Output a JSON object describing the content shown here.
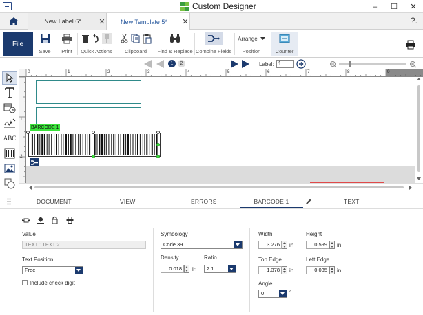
{
  "window": {
    "title": "Custom Designer",
    "controls": [
      "–",
      "☐",
      "✕"
    ]
  },
  "tabs": {
    "items": [
      {
        "label": "New Label 6*",
        "close": "✕"
      },
      {
        "label": "New Template 5*",
        "close": "✕"
      }
    ],
    "help": "?."
  },
  "ribbon": {
    "file": "File",
    "save": "Save",
    "print": "Print",
    "quick_actions": "Quick Actions",
    "clipboard": "Clipboard",
    "find_replace": "Find & Replace",
    "combine_fields": "Combine Fields",
    "arrange": "Arrange",
    "position": "Position",
    "counter": "Counter"
  },
  "nav": {
    "pages": [
      "1",
      "2"
    ],
    "current_page": 1,
    "label_caption": "Label:",
    "label_value": "1"
  },
  "tools": [
    "Select",
    "Text",
    "Date/Time",
    "Signature",
    "ABC",
    "Barcode",
    "Picture",
    "Shape"
  ],
  "tool_abc": "ABC",
  "ruler": {
    "marks": [
      "0",
      "1",
      "2",
      "3",
      "4",
      "5",
      "6",
      "7",
      "8",
      "9"
    ],
    "vmarks": [
      "1",
      "2"
    ]
  },
  "canvas": {
    "barcode_label": "BARCODE 1"
  },
  "panel_tabs": [
    "DOCUMENT",
    "VIEW",
    "ERRORS",
    "BARCODE 1",
    "TEXT"
  ],
  "props": {
    "value_label": "Value",
    "value": "TEXT 1TEXT 2",
    "text_position_label": "Text Position",
    "text_position": "Free",
    "check_digit": "Include check digit",
    "symbology_label": "Symbology",
    "symbology": "Code 39",
    "density_label": "Density",
    "density": "0.018",
    "density_unit": "in",
    "ratio_label": "Ratio",
    "ratio": "2:1",
    "width_label": "Width",
    "width": "3.276",
    "width_unit": "in",
    "height_label": "Height",
    "height": "0.599",
    "height_unit": "in",
    "top_edge_label": "Top Edge",
    "top_edge": "1.378",
    "top_edge_unit": "in",
    "left_edge_label": "Left Edge",
    "left_edge": "0.035",
    "left_edge_unit": "in",
    "angle_label": "Angle",
    "angle": "0",
    "angle_unit": "°"
  },
  "colors": {
    "accent": "#1b3a6e",
    "selection_green": "#3be33b",
    "textbox_border": "#2f8a8a"
  }
}
